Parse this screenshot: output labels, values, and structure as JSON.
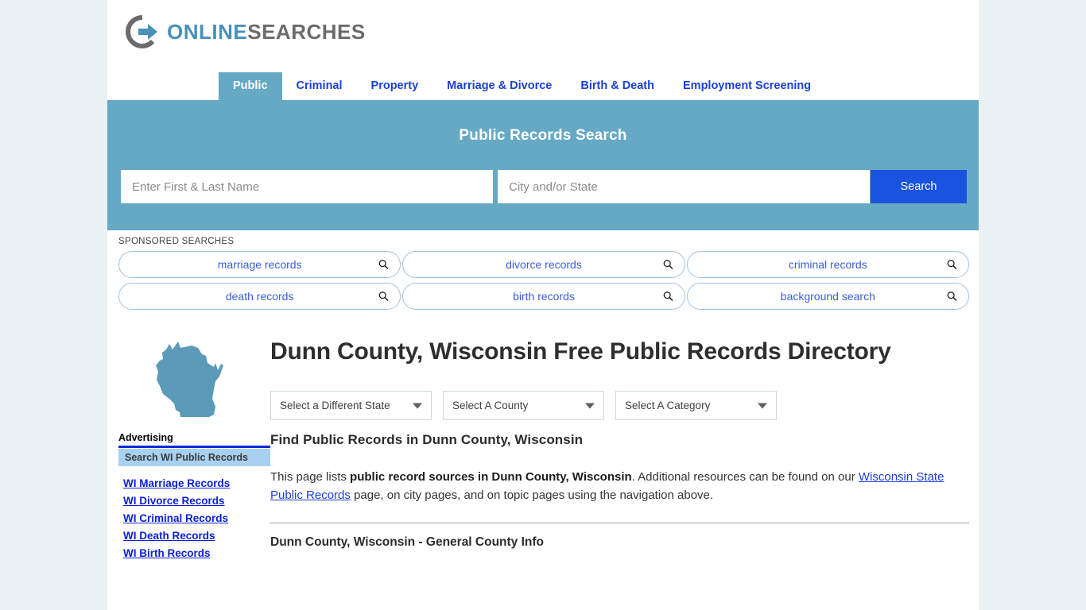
{
  "brand": {
    "name_part1": "ONLINE",
    "name_part2": "SEARCHES",
    "logo_icon": "circle-arrow-right-icon",
    "blue": "#4a90b8",
    "gray": "#6b6b6b"
  },
  "nav": {
    "tabs": [
      {
        "label": "Public",
        "active": true
      },
      {
        "label": "Criminal",
        "active": false
      },
      {
        "label": "Property",
        "active": false
      },
      {
        "label": "Marriage & Divorce",
        "active": false
      },
      {
        "label": "Birth & Death",
        "active": false
      },
      {
        "label": "Employment Screening",
        "active": false
      }
    ]
  },
  "search": {
    "title": "Public Records Search",
    "name_placeholder": "Enter First & Last Name",
    "name_value": "",
    "city_placeholder": "City and/or State",
    "city_value": "",
    "button_label": "Search",
    "banner_color": "#66a9c4",
    "button_color": "#1a53dd"
  },
  "sponsored": {
    "label": "SPONSORED SEARCHES",
    "row1": [
      {
        "label": "marriage records",
        "icon": "search-icon"
      },
      {
        "label": "divorce records",
        "icon": "search-icon"
      },
      {
        "label": "criminal records",
        "icon": "search-icon"
      }
    ],
    "row2": [
      {
        "label": "death records",
        "icon": "search-icon"
      },
      {
        "label": "birth records",
        "icon": "search-icon"
      },
      {
        "label": "background search",
        "icon": "search-icon"
      }
    ]
  },
  "hero": {
    "state_icon": "wisconsin-state-outline-icon",
    "state_icon_color": "#5b9bb8",
    "title": "Dunn County, Wisconsin Free Public Records Directory"
  },
  "selectors": [
    {
      "label": "Select a Different State",
      "icon": "chevron-down-icon"
    },
    {
      "label": "Select A County",
      "icon": "chevron-down-icon"
    },
    {
      "label": "Select A Category",
      "icon": "chevron-down-icon"
    }
  ],
  "sidebar": {
    "heading": "Advertising",
    "banner": "Search WI Public Records",
    "links": [
      "WI Marriage Records",
      "WI Divorce Records",
      "WI Criminal Records",
      "WI Death Records",
      "WI Birth Records"
    ]
  },
  "main": {
    "section_heading": "Find Public Records in Dunn County, Wisconsin",
    "paragraph": {
      "part1": "This page lists ",
      "bold1": "public record sources in Dunn County, Wisconsin",
      "part2": ". Additional resources can be found on our ",
      "link": "Wisconsin State Public Records",
      "part3": " page, on city pages, and on topic pages using the navigation above."
    },
    "subsection_title": "Dunn County, Wisconsin - General County Info"
  }
}
